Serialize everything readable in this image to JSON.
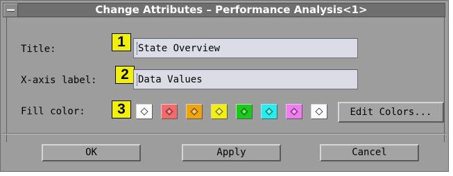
{
  "window": {
    "title": "Change Attributes – Performance Analysis<1>"
  },
  "form": {
    "title_label": "Title:",
    "title_value": "State Overview",
    "xaxis_label": "X-axis label:",
    "xaxis_value": "Data Values",
    "fill_label": "Fill color:"
  },
  "callouts": [
    "1",
    "2",
    "3"
  ],
  "swatches": [
    {
      "color": "#ffffff",
      "diamond": "#ffffff"
    },
    {
      "color": "#f46a6a",
      "diamond": "#ee3a3a"
    },
    {
      "color": "#f2a400",
      "diamond": "#ee9200"
    },
    {
      "color": "#f2f200",
      "diamond": "#eaea00"
    },
    {
      "color": "#14ce14",
      "diamond": "#00bf00"
    },
    {
      "color": "#1cf2f2",
      "diamond": "#00dede"
    },
    {
      "color": "#f47af4",
      "diamond": "#e85ce8"
    },
    {
      "color": "#ffffff",
      "diamond": "#ffffff"
    }
  ],
  "buttons": {
    "edit_colors": "Edit Colors...",
    "ok": "OK",
    "apply": "Apply",
    "cancel": "Cancel"
  },
  "icons": {
    "window_menu": "window-menu-icon",
    "swatch_marker": "diamond-icon"
  }
}
